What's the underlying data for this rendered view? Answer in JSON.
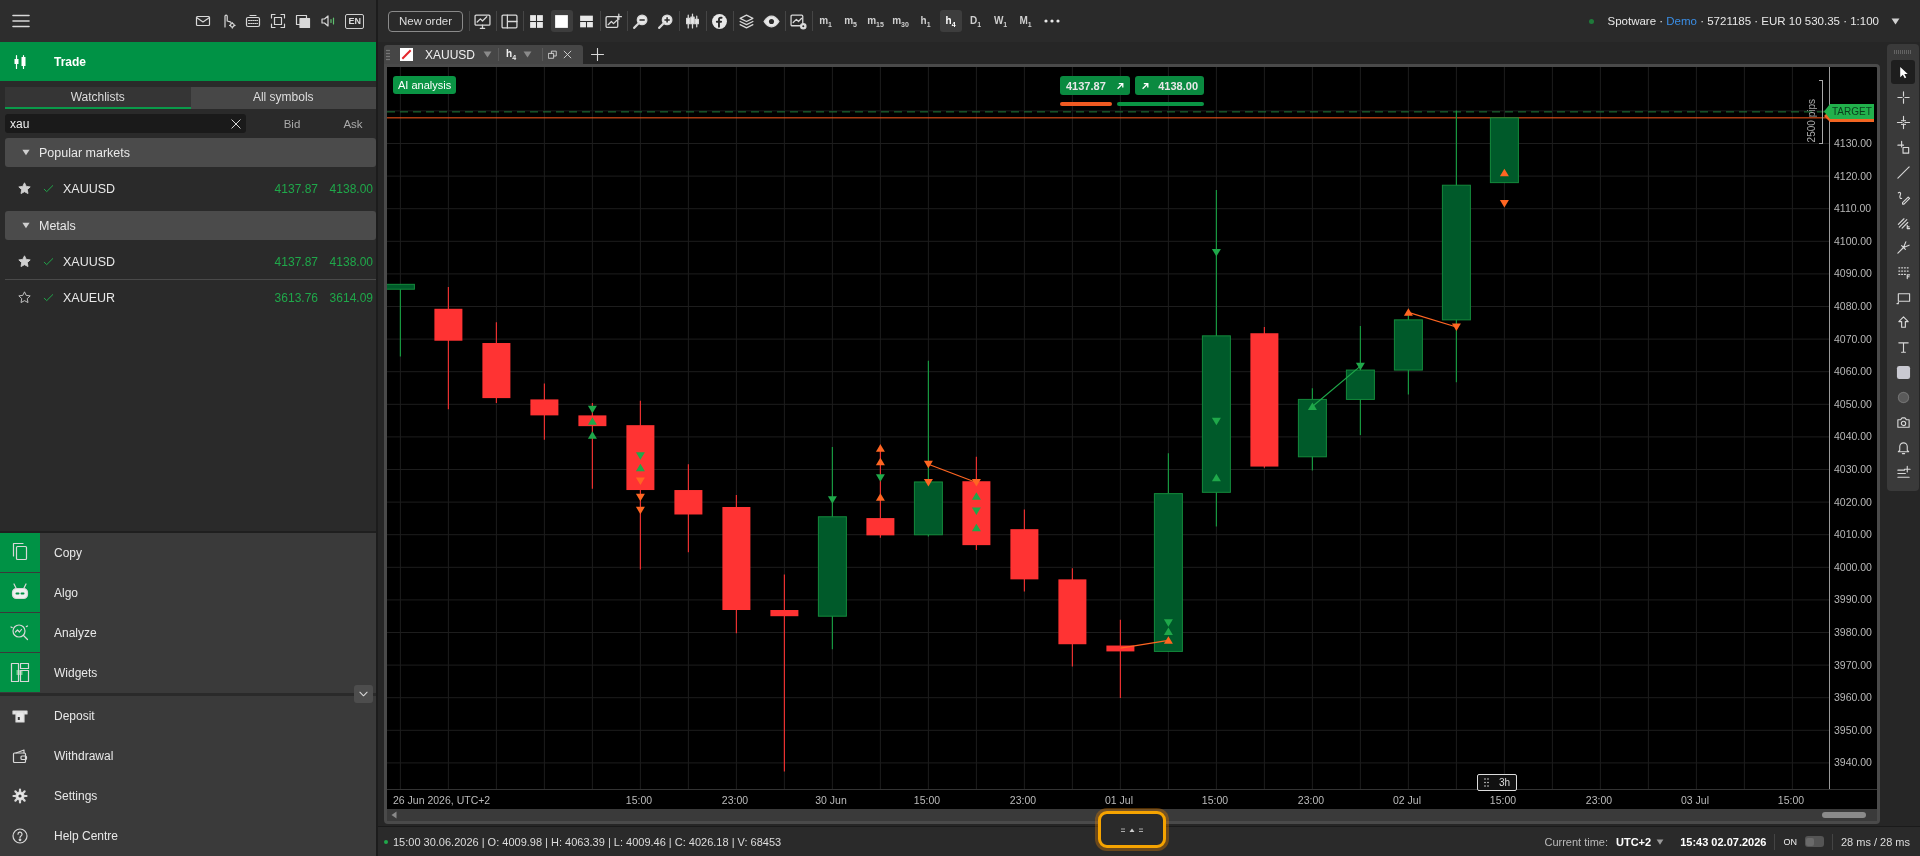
{
  "sidebar": {
    "language": "EN",
    "sections": [
      {
        "label": "Trade",
        "selected": true
      }
    ],
    "watchlist_tabs": [
      {
        "label": "Watchlists",
        "selected": true
      },
      {
        "label": "All symbols",
        "selected": false
      }
    ],
    "search": {
      "value": "xau"
    },
    "columns": [
      "Bid",
      "Ask"
    ],
    "groups": [
      {
        "name": "Popular markets",
        "expanded": true,
        "symbols": [
          {
            "symbol": "XAUUSD",
            "favorite": true,
            "bid": "4137.87",
            "ask": "4138.00"
          }
        ]
      },
      {
        "name": "Metals",
        "expanded": true,
        "symbols": [
          {
            "symbol": "XAUUSD",
            "favorite": true,
            "bid": "4137.87",
            "ask": "4138.00"
          },
          {
            "symbol": "XAUEUR",
            "favorite": false,
            "bid": "3613.76",
            "ask": "3614.09"
          }
        ]
      }
    ],
    "apps": [
      {
        "label": "Copy",
        "selected": false
      },
      {
        "label": "Algo",
        "selected": false
      },
      {
        "label": "Analyze",
        "selected": false
      },
      {
        "label": "Widgets",
        "selected": false
      }
    ],
    "links": [
      "Deposit",
      "Withdrawal",
      "Settings",
      "Help Centre"
    ]
  },
  "toolbar": {
    "new_order": "New order",
    "layouts": [
      {
        "selected": false
      },
      {
        "selected": true
      },
      {
        "selected": false
      }
    ],
    "timeframes": [
      {
        "label": "m$_{1}$",
        "selected": false
      },
      {
        "label": "m$_{5}$",
        "selected": false
      },
      {
        "label": "m$_{15}$",
        "selected": false
      },
      {
        "label": "m$_{30}$",
        "selected": false
      },
      {
        "label": "h$_{1}$",
        "selected": false
      },
      {
        "label": "h$_{4}$",
        "selected": true
      },
      {
        "label": "D$_{1}$",
        "selected": false
      },
      {
        "label": "W$_{1}$",
        "selected": false
      },
      {
        "label": "M$_{1}$",
        "selected": false
      }
    ]
  },
  "account": {
    "connected": true,
    "broker": "Spotware ·",
    "type": "Demo",
    "details": "· 5721185 · EUR 10 530.35 · 1:100"
  },
  "chart_tab": {
    "symbol": "XAUUSD",
    "timeframe": "h$_{4}$"
  },
  "chart": {
    "ai_button": "AI analysis",
    "sell_price": "4137.87",
    "buy_price": "4138.00",
    "target_label": "TARGET",
    "pips_label": "2500 pips",
    "price_axis": [
      "4130.00",
      "4120.00",
      "4110.00",
      "4100.00",
      "4090.00",
      "4080.00",
      "4070.00",
      "4060.00",
      "4050.00",
      "4040.00",
      "4030.00",
      "4020.00",
      "4010.00",
      "4000.00",
      "3990.00",
      "3980.00",
      "3970.00",
      "3960.00",
      "3950.00",
      "3940.00"
    ],
    "time_axis": [
      "26 Jun 2026, UTC+2",
      "15:00",
      "23:00",
      "30 Jun",
      "15:00",
      "23:00",
      "01 Jul",
      "15:00",
      "23:00",
      "02 Jul",
      "15:00",
      "23:00",
      "03 Jul",
      "15:00"
    ],
    "interval_badge": "3h"
  },
  "drawing_tools": [
    {
      "selected": true
    },
    {
      "selected": false
    },
    {
      "selected": false
    },
    {
      "selected": false
    },
    {
      "selected": false
    },
    {
      "selected": false
    },
    {
      "selected": false
    },
    {
      "selected": false
    },
    {
      "selected": false
    },
    {
      "selected": false
    },
    {
      "selected": false
    },
    {
      "selected": false
    },
    {
      "selected": false
    },
    {
      "selected": false
    },
    {
      "selected": false
    },
    {
      "selected": false
    },
    {
      "selected": false
    }
  ],
  "status_bar": {
    "connected": true,
    "ohlc": "15:00 30.06.2026 | O: 4009.98 | H: 4063.39 | L: 4009.46 | C: 4026.18 | V: 68453",
    "current_time_label": "Current time:",
    "timezone": "UTC+2",
    "time": "15:43 02.07.2026",
    "toggle": {
      "label": "ON",
      "on": false
    },
    "latency": "28 ms / 28 ms"
  }
}
